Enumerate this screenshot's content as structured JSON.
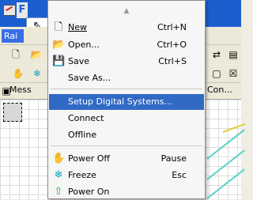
{
  "window": {
    "app_initial": "F",
    "menu_rail_label": "Rai"
  },
  "toolbar": {
    "message_label": "Mess",
    "con_label": "Con..."
  },
  "menu": {
    "items": [
      {
        "label": "New",
        "accel": "Ctrl+N",
        "icon": "new-document-icon"
      },
      {
        "label": "Open...",
        "accel": "Ctrl+O",
        "icon": "open-folder-icon"
      },
      {
        "label": "Save",
        "accel": "Ctrl+S",
        "icon": "save-disk-icon"
      },
      {
        "label": "Save As...",
        "accel": "",
        "icon": ""
      },
      {
        "label": "Setup Digital Systems...",
        "accel": "",
        "icon": ""
      },
      {
        "label": "Connect",
        "accel": "",
        "icon": ""
      },
      {
        "label": "Offline",
        "accel": "",
        "icon": ""
      },
      {
        "label": "Power Off",
        "accel": "Pause",
        "icon": "power-off-hand-icon"
      },
      {
        "label": "Freeze",
        "accel": "Esc",
        "icon": "freeze-snowflake-icon"
      },
      {
        "label": "Power On",
        "accel": "",
        "icon": "power-on-arrow-icon"
      }
    ],
    "highlight_color": "#316ac5"
  }
}
